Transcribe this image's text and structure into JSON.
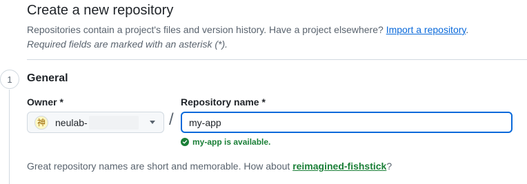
{
  "header": {
    "title": "Create a new repository",
    "subtitle_text": "Repositories contain a project's files and version history. Have a project elsewhere? ",
    "import_link": "Import a repository",
    "subtitle_end": ".",
    "required_note": "Required fields are marked with an asterisk (*)."
  },
  "step": {
    "number": "1",
    "title": "General"
  },
  "owner": {
    "label": "Owner *",
    "value": "neulab-",
    "avatar_glyph": "神"
  },
  "separator": "/",
  "repository": {
    "label": "Repository name *",
    "value": "my-app",
    "availability": "my-app is available."
  },
  "suggestion": {
    "text": "Great repository names are short and memorable. How about ",
    "name": "reimagined-fishstick",
    "end": "?"
  },
  "colors": {
    "link": "#0969da",
    "success": "#1a7f37",
    "focus_border": "#0969da"
  },
  "icons": [
    "caret-down-icon",
    "check-circle-icon"
  ]
}
